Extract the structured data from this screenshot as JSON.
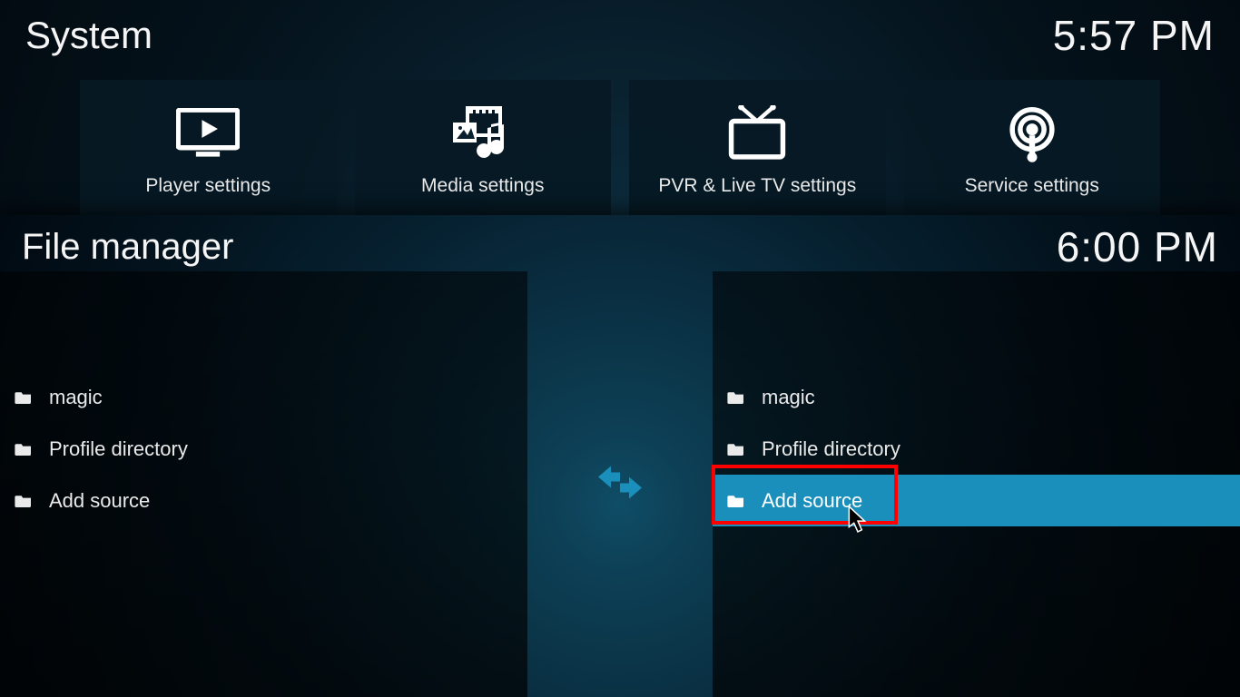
{
  "bg": {
    "title": "System",
    "clock": "5:57 PM",
    "tiles": [
      {
        "label": "Player settings"
      },
      {
        "label": "Media settings"
      },
      {
        "label": "PVR & Live TV settings"
      },
      {
        "label": "Service settings"
      }
    ]
  },
  "fg": {
    "title": "File manager",
    "clock": "6:00 PM"
  },
  "left": {
    "items": [
      {
        "label": "magic"
      },
      {
        "label": "Profile directory"
      },
      {
        "label": "Add source"
      }
    ]
  },
  "right": {
    "items": [
      {
        "label": "magic"
      },
      {
        "label": "Profile directory"
      },
      {
        "label": "Add source"
      }
    ]
  }
}
